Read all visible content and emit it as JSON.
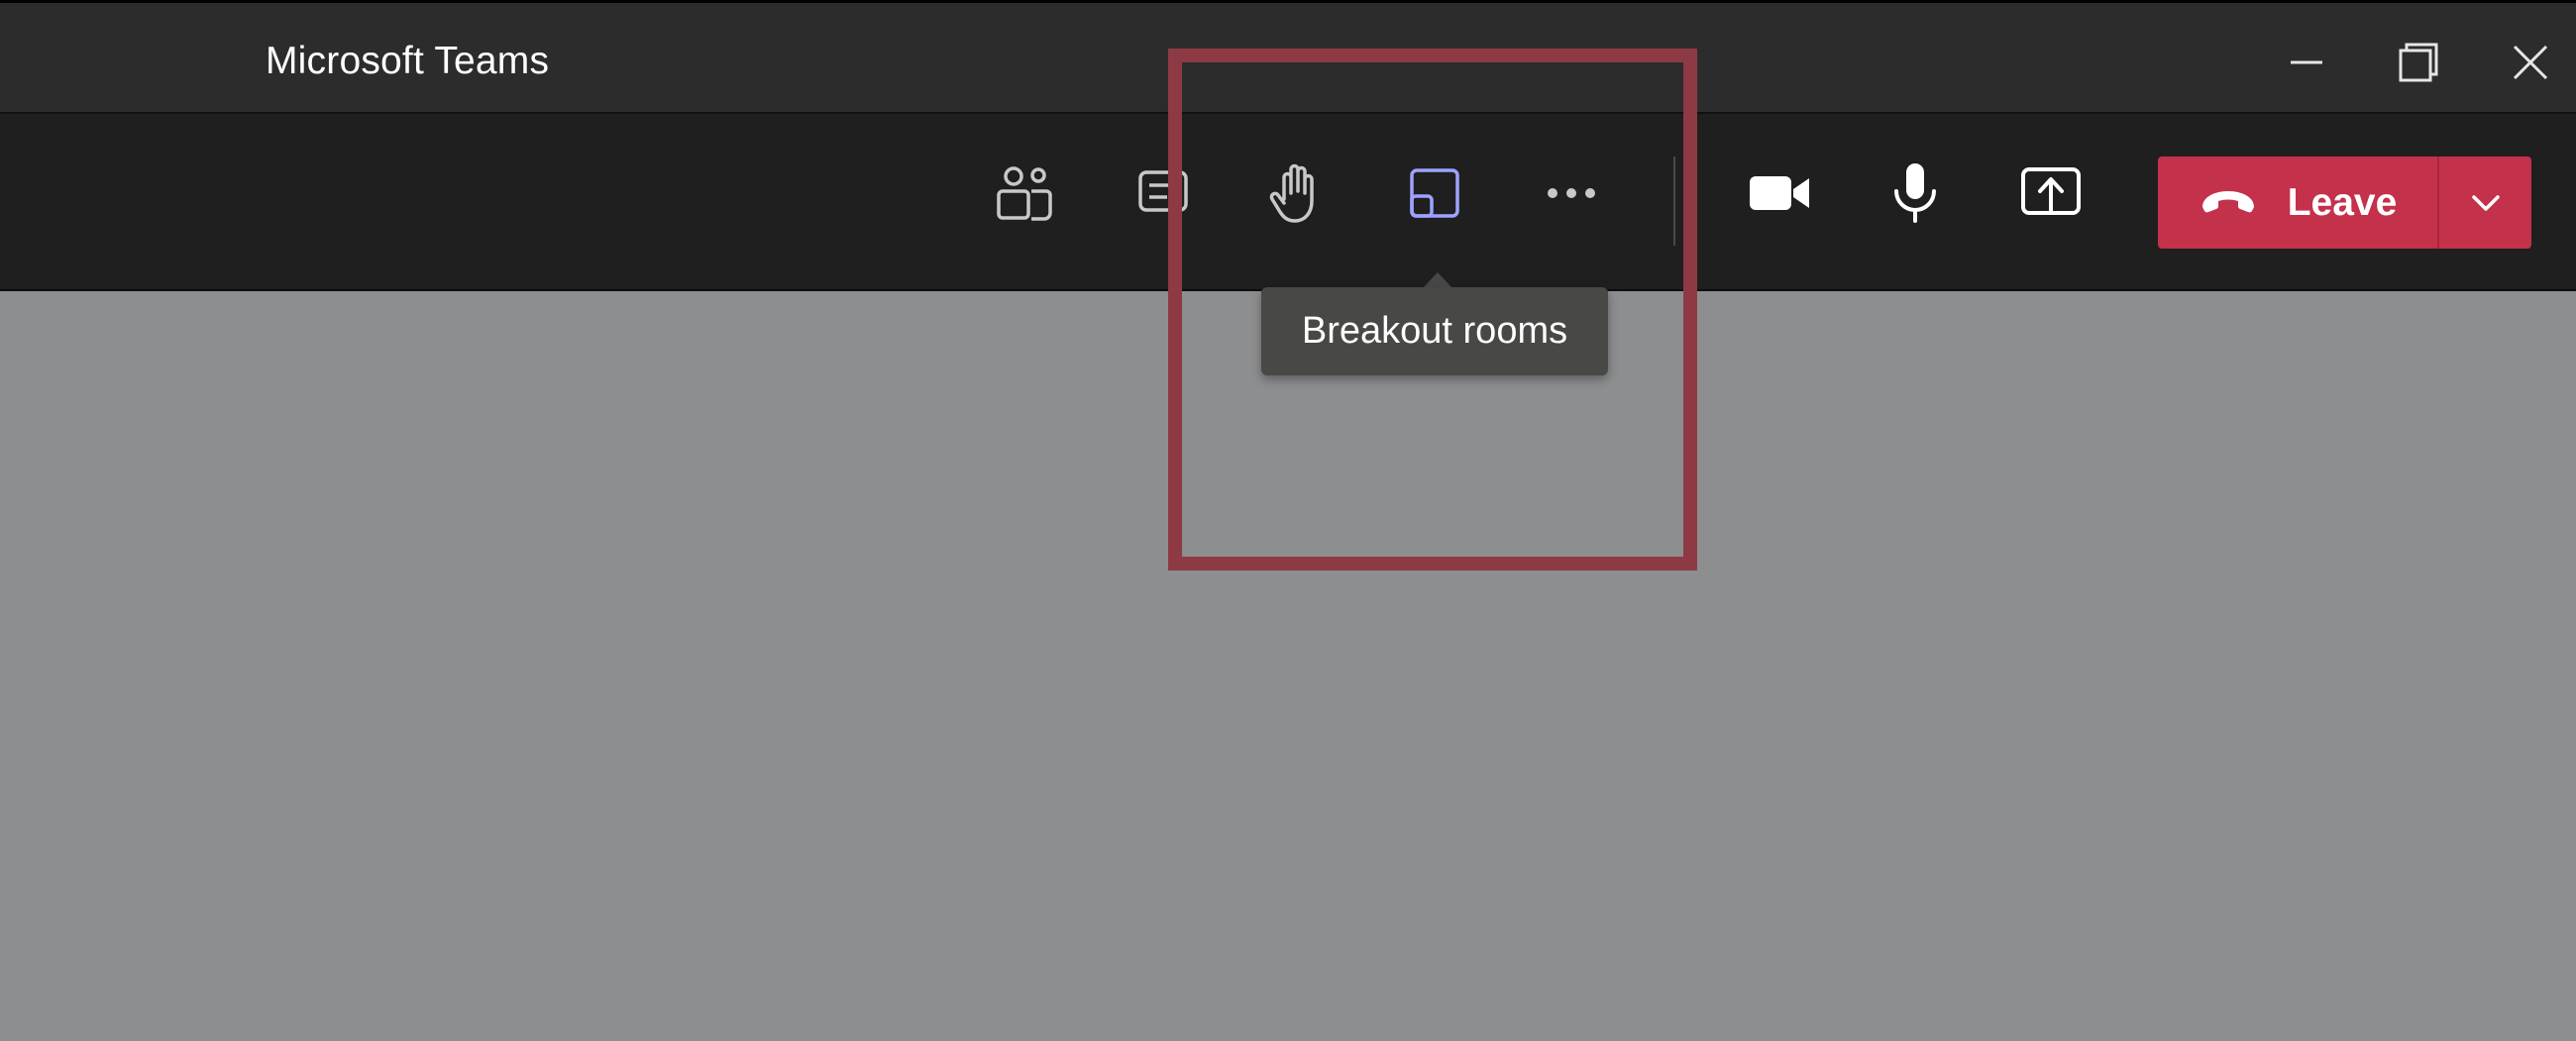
{
  "window": {
    "title": "Microsoft Teams",
    "controls": {
      "minimize_icon": "minimize-icon",
      "restore_icon": "restore-icon",
      "close_icon": "close-icon"
    }
  },
  "toolbar": {
    "buttons": [
      {
        "icon": "participants-icon"
      },
      {
        "icon": "chat-icon"
      },
      {
        "icon": "raise-hand-icon"
      },
      {
        "icon": "breakout-rooms-icon"
      },
      {
        "icon": "more-options-icon"
      },
      {
        "icon": "camera-icon"
      },
      {
        "icon": "microphone-icon"
      },
      {
        "icon": "share-screen-icon"
      }
    ],
    "leave": {
      "label": "Leave",
      "icon": "hang-up-icon",
      "dropdown_icon": "chevron-down-icon",
      "color": "#c4314b"
    }
  },
  "tooltip": {
    "text": "Breakout rooms"
  },
  "colors": {
    "titlebar": "#2c2c2c",
    "toolbar": "#1f1f1f",
    "stage": "#8d8e90",
    "accent": "#9ea2ff",
    "highlight": "#8e3a45"
  }
}
